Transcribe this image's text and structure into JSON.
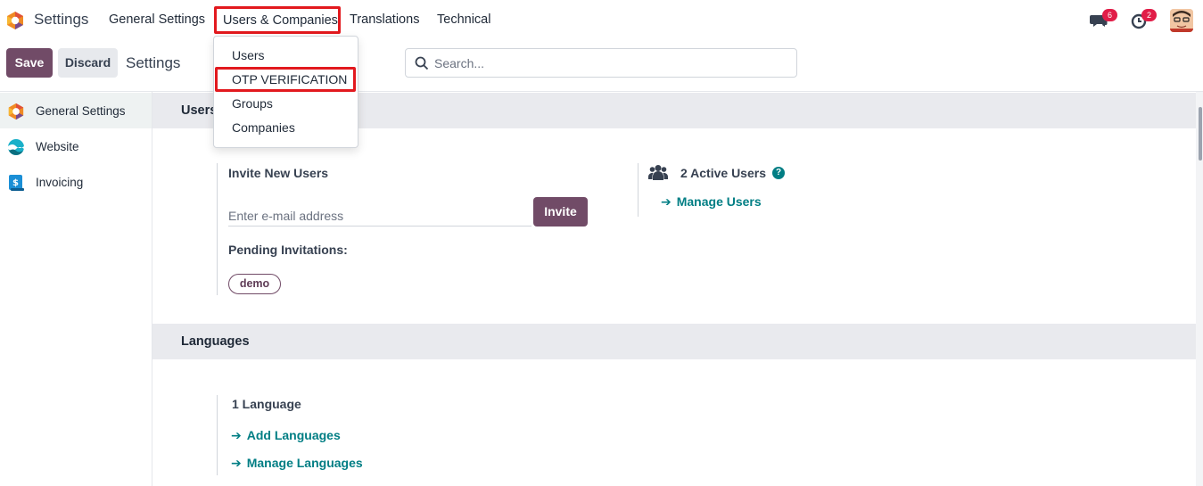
{
  "app": {
    "title": "Settings"
  },
  "topbar": {
    "menu": [
      "General Settings",
      "Users & Companies",
      "Translations",
      "Technical"
    ],
    "messages_count": "6",
    "activity_count": "2"
  },
  "dropdown": {
    "items": [
      "Users",
      "OTP VERIFICATION",
      "Groups",
      "Companies"
    ]
  },
  "control_panel": {
    "save_label": "Save",
    "discard_label": "Discard",
    "title": "Settings",
    "search_placeholder": "Search..."
  },
  "sidebar": {
    "items": [
      {
        "label": "General Settings",
        "icon": "settings-app-icon"
      },
      {
        "label": "Website",
        "icon": "website-app-icon"
      },
      {
        "label": "Invoicing",
        "icon": "invoicing-app-icon"
      }
    ]
  },
  "users_section": {
    "heading": "Users",
    "invite_title": "Invite New Users",
    "email_placeholder": "Enter e-mail address",
    "invite_label": "Invite",
    "pending_label": "Pending Invitations:",
    "pending_tag": "demo",
    "active_users": "2 Active Users",
    "manage_users": "Manage Users"
  },
  "languages_section": {
    "heading": "Languages",
    "count": "1 Language",
    "add_link": "Add Languages",
    "manage_link": "Manage Languages"
  },
  "colors": {
    "brand": "#714b67",
    "link": "#017e84",
    "highlight": "#e2191e"
  }
}
